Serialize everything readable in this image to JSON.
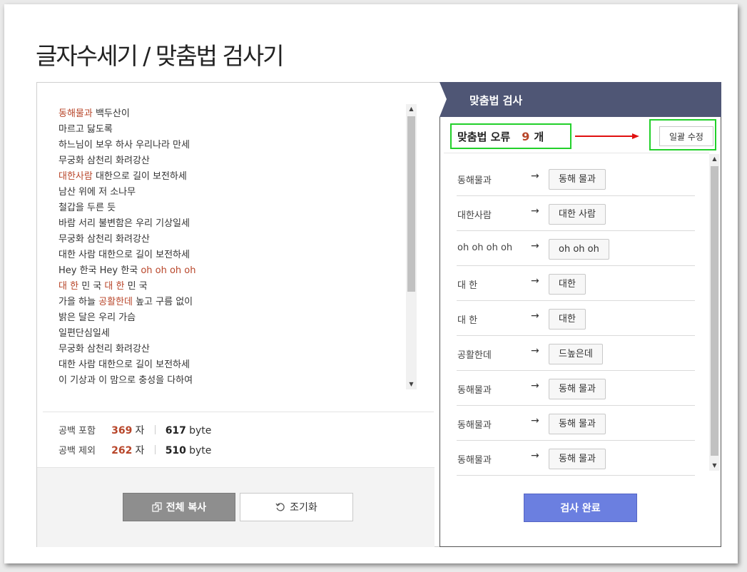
{
  "page": {
    "title": "글자수세기 / 맞춤법 검사기"
  },
  "editor": {
    "lines": [
      [
        {
          "t": "동해물과",
          "e": true
        },
        {
          "t": " 백두산이",
          "e": false
        }
      ],
      [
        {
          "t": "마르고 닳도록",
          "e": false
        }
      ],
      [
        {
          "t": "하느님이 보우 하사 우리나라 만세",
          "e": false
        }
      ],
      [
        {
          "t": "무궁화 삼천리 화려강산",
          "e": false
        }
      ],
      [
        {
          "t": "대한사람",
          "e": true
        },
        {
          "t": " 대한으로 길이 보전하세",
          "e": false
        }
      ],
      [
        {
          "t": "남산 위에 저 소나무",
          "e": false
        }
      ],
      [
        {
          "t": "철갑을 두른 듯",
          "e": false
        }
      ],
      [
        {
          "t": "바람 서리 불변함은 우리 기상일세",
          "e": false
        }
      ],
      [
        {
          "t": "무궁화 삼천리 화려강산",
          "e": false
        }
      ],
      [
        {
          "t": "대한 사람 대한으로 길이 보전하세",
          "e": false
        }
      ],
      [
        {
          "t": "Hey 한국 Hey 한국 ",
          "e": false
        },
        {
          "t": "oh oh oh oh",
          "e": true
        }
      ],
      [
        {
          "t": "대 한",
          "e": true
        },
        {
          "t": " 민 국 ",
          "e": false
        },
        {
          "t": "대 한",
          "e": true
        },
        {
          "t": " 민 국",
          "e": false
        }
      ],
      [
        {
          "t": "가을 하늘 ",
          "e": false
        },
        {
          "t": "공활한데",
          "e": true
        },
        {
          "t": " 높고 구름 없이",
          "e": false
        }
      ],
      [
        {
          "t": "밝은 달은 우리 가슴",
          "e": false
        }
      ],
      [
        {
          "t": "일편단심일세",
          "e": false
        }
      ],
      [
        {
          "t": "무궁화 삼천리 화려강산",
          "e": false
        }
      ],
      [
        {
          "t": "대한 사람 대한으로 길이 보전하세",
          "e": false
        }
      ],
      [
        {
          "t": "이 기상과 이 맘으로 충성을 다하여",
          "e": false
        }
      ]
    ]
  },
  "stats": {
    "with_space": {
      "label": "공백 포함",
      "chars": "369",
      "char_unit": "자",
      "bytes": "617",
      "byte_unit": "byte"
    },
    "without_space": {
      "label": "공백 제외",
      "chars": "262",
      "char_unit": "자",
      "bytes": "510",
      "byte_unit": "byte"
    }
  },
  "buttons": {
    "copy_all": "전체 복사",
    "reset": "조기화",
    "done": "검사 완료",
    "fix_all": "일괄 수정"
  },
  "spellcheck": {
    "header": "맞춤법 검사",
    "error_label": "맞춤법 오류",
    "error_count": "9",
    "error_unit": "개",
    "arrow": "→",
    "corrections": [
      {
        "original": "동해물과",
        "suggestion": "동해 물과"
      },
      {
        "original": "대한사람",
        "suggestion": "대한 사람"
      },
      {
        "original": "oh oh oh oh",
        "suggestion": "oh oh oh"
      },
      {
        "original": "대 한",
        "suggestion": "대한"
      },
      {
        "original": "대 한",
        "suggestion": "대한"
      },
      {
        "original": "공활한데",
        "suggestion": "드높은데"
      },
      {
        "original": "동해물과",
        "suggestion": "동해 물과"
      },
      {
        "original": "동해물과",
        "suggestion": "동해 물과"
      },
      {
        "original": "동해물과",
        "suggestion": "동해 물과"
      }
    ]
  },
  "colors": {
    "error_text": "#b8462a",
    "header_bg": "#4f5675",
    "highlight_box": "#22d02a",
    "annotation_arrow": "#e01010",
    "done_button": "#6b7fe0"
  }
}
